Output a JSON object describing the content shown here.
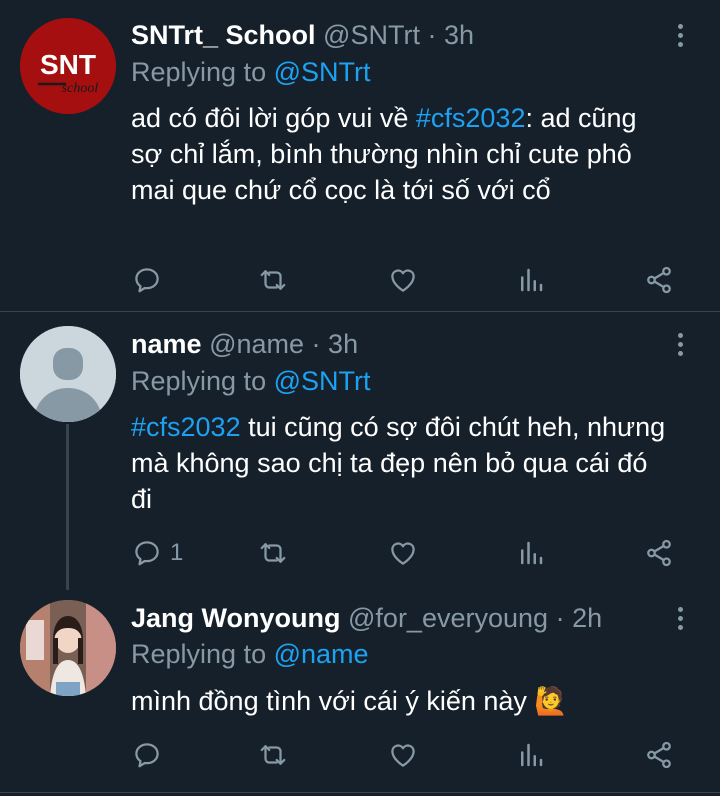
{
  "tweets": [
    {
      "name": "SNTrt_ School",
      "handle": "@SNTrt",
      "time": "3h",
      "replying_label": "Replying to",
      "replying_to": "@SNTrt",
      "avatar": {
        "icon": "snt-school-logo",
        "text_main": "SNT",
        "text_sub": "school",
        "color": "#a50f0f"
      },
      "body_parts": [
        "ad có đôi lời góp vui về ",
        "#cfs2032",
        ": ad cũng sợ chỉ lắm, bình thường nhìn chỉ cute phô mai que chứ cổ cọc là tới số với cổ"
      ],
      "reply_count": ""
    },
    {
      "name": "name",
      "handle": "@name",
      "time": "3h",
      "replying_label": "Replying to",
      "replying_to": "@SNTrt",
      "avatar": {
        "icon": "default-avatar-icon"
      },
      "body_parts": [
        "#cfs2032",
        " tui cũng có sợ đôi chút heh, nhưng mà không sao chị ta đẹp nên bỏ qua cái đó đi"
      ],
      "reply_count": "1"
    },
    {
      "name": "Jang Wonyoung",
      "handle": "@for_everyoung",
      "time": "2h",
      "replying_label": "Replying to",
      "replying_to": "@name",
      "avatar": {
        "icon": "profile-photo"
      },
      "body_parts": [
        "mình đồng tình với cái ý kiến này ",
        "🙋"
      ],
      "reply_count": ""
    }
  ],
  "separator": "·",
  "colors": {
    "background": "#15202b",
    "secondary_text": "#8899a6",
    "link": "#1da1f2",
    "divider": "#38444d"
  }
}
